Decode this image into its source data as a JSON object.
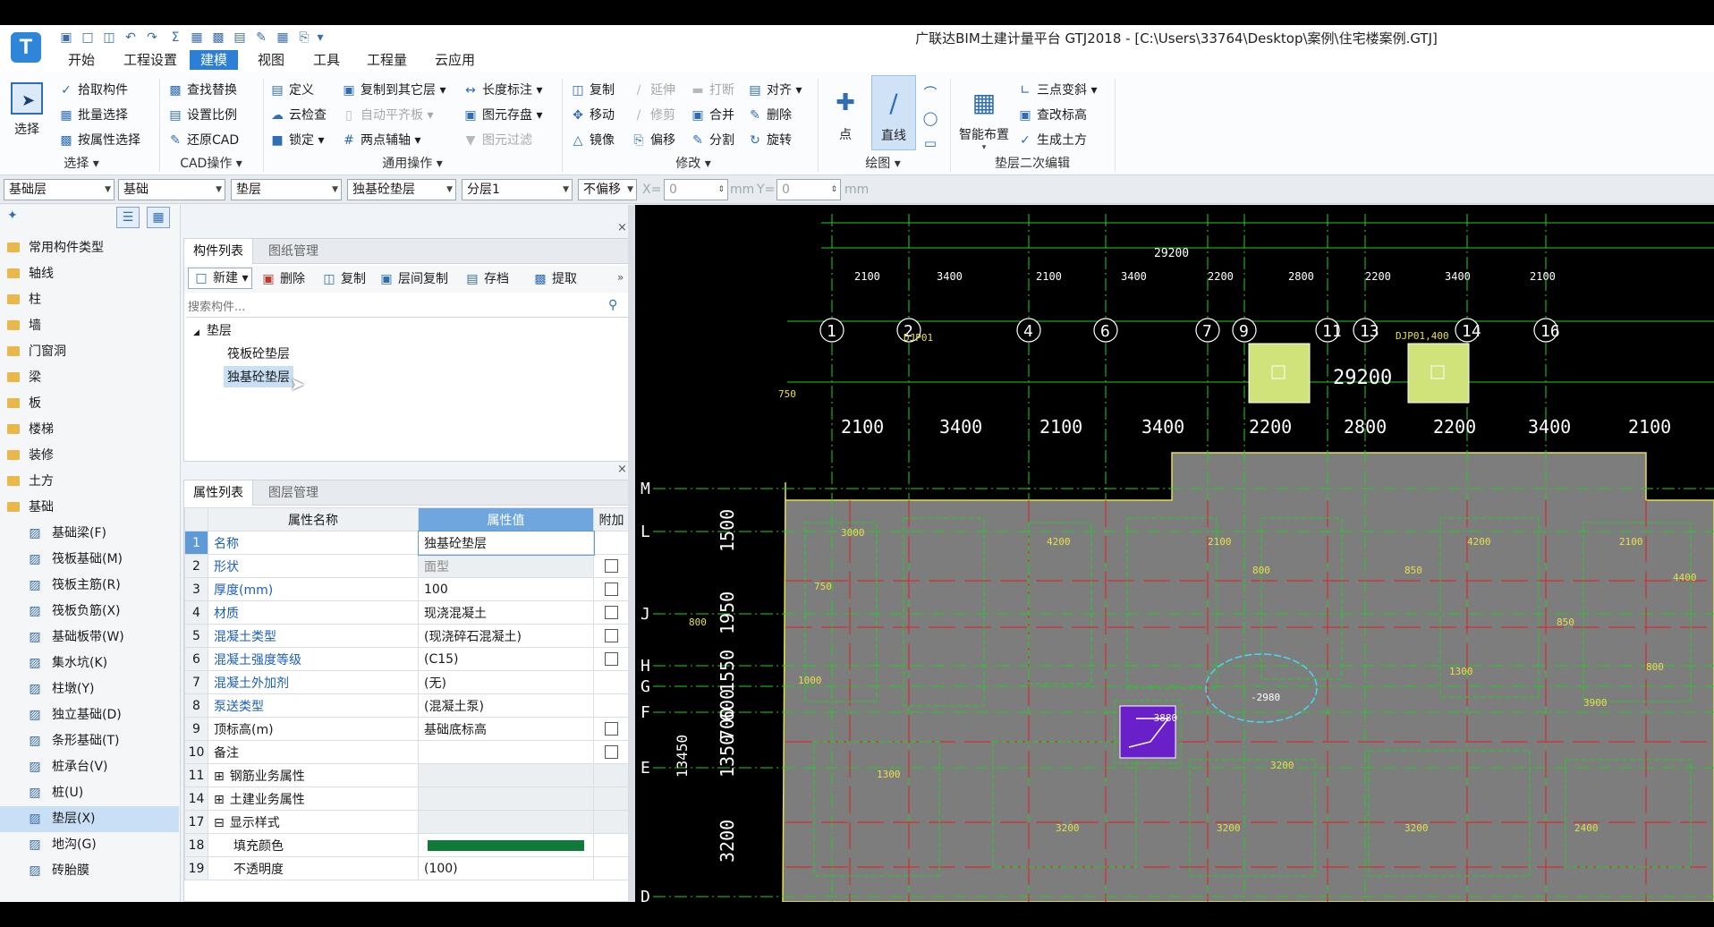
{
  "app": {
    "window_title": "广联达BIM土建计量平台 GTJ2018 - [C:\\Users\\33764\\Desktop\\案例\\住宅楼案例.GTJ]",
    "logo_letter": "T",
    "tabs": [
      "开始",
      "工程设置",
      "建模",
      "视图",
      "工具",
      "工程量",
      "云应用"
    ],
    "active_tab": "建模"
  },
  "ribbon": {
    "select_label": "选择",
    "group_select": [
      "拾取构件",
      "批量选择",
      "按属性选择"
    ],
    "group_select_title": "选择",
    "group_cad": [
      "查找替换",
      "设置比例",
      "还原CAD"
    ],
    "group_cad_title": "CAD操作",
    "group_general_col1": [
      "定义",
      "云检查",
      "锁定"
    ],
    "group_general_col2": [
      "复制到其它层",
      "自动平齐板",
      "两点辅轴"
    ],
    "group_general_col3": [
      "长度标注",
      "图元存盘",
      "图元过滤"
    ],
    "group_general_title": "通用操作",
    "group_modify_col1": [
      "复制",
      "移动",
      "镜像"
    ],
    "group_modify_col2": [
      "延伸",
      "修剪",
      "偏移"
    ],
    "group_modify_col3": [
      "打断",
      "合并",
      "分割"
    ],
    "group_modify_col4": [
      "对齐",
      "删除",
      "旋转"
    ],
    "group_modify_title": "修改",
    "group_draw_point": "点",
    "group_draw_line": "直线",
    "group_draw_title": "绘图",
    "group_cushion_big": "智能布置",
    "group_cushion_items": [
      "三点变斜",
      "查改标高",
      "生成土方"
    ],
    "group_cushion_title": "垫层二次编辑"
  },
  "selectors": {
    "floor": "基础层",
    "category": "基础",
    "type": "垫层",
    "component": "独基砼垫层",
    "layer": "分层1",
    "offset": "不偏移",
    "x_label": "X=",
    "x_value": "0",
    "x_unit": "mm",
    "y_label": "Y=",
    "y_value": "0",
    "y_unit": "mm"
  },
  "nav": {
    "items": [
      {
        "label": "常用构件类型",
        "kind": "folder"
      },
      {
        "label": "轴线",
        "kind": "folder"
      },
      {
        "label": "柱",
        "kind": "folder"
      },
      {
        "label": "墙",
        "kind": "folder"
      },
      {
        "label": "门窗洞",
        "kind": "folder"
      },
      {
        "label": "梁",
        "kind": "folder"
      },
      {
        "label": "板",
        "kind": "folder"
      },
      {
        "label": "楼梯",
        "kind": "folder"
      },
      {
        "label": "装修",
        "kind": "folder"
      },
      {
        "label": "土方",
        "kind": "folder"
      },
      {
        "label": "基础",
        "kind": "folder-open"
      },
      {
        "label": "基础梁(F)",
        "kind": "sub"
      },
      {
        "label": "筏板基础(M)",
        "kind": "sub"
      },
      {
        "label": "筏板主筋(R)",
        "kind": "sub"
      },
      {
        "label": "筏板负筋(X)",
        "kind": "sub"
      },
      {
        "label": "基础板带(W)",
        "kind": "sub"
      },
      {
        "label": "集水坑(K)",
        "kind": "sub"
      },
      {
        "label": "柱墩(Y)",
        "kind": "sub"
      },
      {
        "label": "独立基础(D)",
        "kind": "sub"
      },
      {
        "label": "条形基础(T)",
        "kind": "sub"
      },
      {
        "label": "桩承台(V)",
        "kind": "sub"
      },
      {
        "label": "桩(U)",
        "kind": "sub"
      },
      {
        "label": "垫层(X)",
        "kind": "sub-selected"
      },
      {
        "label": "地沟(G)",
        "kind": "sub"
      },
      {
        "label": "砖胎膜",
        "kind": "sub"
      }
    ]
  },
  "component_panel": {
    "tabs": [
      "构件列表",
      "图纸管理"
    ],
    "toolbar": [
      "新建",
      "删除",
      "复制",
      "层间复制",
      "存档",
      "提取"
    ],
    "search_placeholder": "搜索构件...",
    "tree_root": "垫层",
    "tree_items": [
      "筏板砼垫层",
      "独基砼垫层"
    ],
    "selected_item": "独基砼垫层"
  },
  "property_panel": {
    "tabs": [
      "属性列表",
      "图层管理"
    ],
    "headers": [
      "属性名称",
      "属性值",
      "附加"
    ],
    "rows": [
      {
        "n": "1",
        "name": "名称",
        "value": "独基砼垫层",
        "blue": true,
        "cb": false
      },
      {
        "n": "2",
        "name": "形状",
        "value": "面型",
        "blue": true,
        "cb": true,
        "grey": true
      },
      {
        "n": "3",
        "name": "厚度(mm)",
        "value": "100",
        "blue": true,
        "cb": true
      },
      {
        "n": "4",
        "name": "材质",
        "value": "现浇混凝土",
        "blue": true,
        "cb": true
      },
      {
        "n": "5",
        "name": "混凝土类型",
        "value": "(现浇碎石混凝土)",
        "blue": true,
        "cb": true
      },
      {
        "n": "6",
        "name": "混凝土强度等级",
        "value": "(C15)",
        "blue": true,
        "cb": true
      },
      {
        "n": "7",
        "name": "混凝土外加剂",
        "value": "(无)",
        "blue": true,
        "cb": false
      },
      {
        "n": "8",
        "name": "泵送类型",
        "value": "(混凝土泵)",
        "blue": true,
        "cb": false
      },
      {
        "n": "9",
        "name": "顶标高(m)",
        "value": "基础底标高",
        "blue": false,
        "cb": true
      },
      {
        "n": "10",
        "name": "备注",
        "value": "",
        "blue": false,
        "cb": true
      },
      {
        "n": "11",
        "name": "钢筋业务属性",
        "value": "",
        "blue": false,
        "cb": false,
        "group": "+"
      },
      {
        "n": "14",
        "name": "土建业务属性",
        "value": "",
        "blue": false,
        "cb": false,
        "group": "+"
      },
      {
        "n": "17",
        "name": "显示样式",
        "value": "",
        "blue": false,
        "cb": false,
        "group": "-"
      },
      {
        "n": "18",
        "name": "填充颜色",
        "value": "",
        "blue": false,
        "cb": false,
        "indent": true,
        "swatch": "#0f7a3a"
      },
      {
        "n": "19",
        "name": "不透明度",
        "value": "(100)",
        "blue": false,
        "cb": false,
        "indent": true
      }
    ]
  },
  "drawing": {
    "top_total": "29200",
    "top_dims": [
      "2100",
      "3400",
      "2100",
      "3400",
      "2200",
      "2800",
      "2200",
      "3400",
      "2100"
    ],
    "axes": [
      "1",
      "2",
      "4",
      "6",
      "7",
      "9",
      "11",
      "13",
      "14",
      "16"
    ],
    "mid_total": "29200",
    "mid_dims": [
      "2100",
      "3400",
      "2100",
      "3400",
      "2200",
      "2800",
      "2200",
      "3400",
      "2100"
    ],
    "row_axes": [
      "M",
      "L",
      "J",
      "H",
      "G",
      "F",
      "E",
      "D"
    ],
    "left_dims": [
      "1500",
      "1950",
      "1550",
      "600",
      "700",
      "1350",
      "3200"
    ],
    "left_total": "13450",
    "small_labels": [
      "DJP01",
      "DJP01,400",
      "3000",
      "4200",
      "2100",
      "4200",
      "2100",
      "4400",
      "1300",
      "1300",
      "3200",
      "3200",
      "3200",
      "3200",
      "2400",
      "1000",
      "800",
      "800",
      "850",
      "750",
      "750",
      "850",
      "800",
      "3900",
      "-3880",
      "-2980"
    ],
    "colors": {
      "grid": "#1fd11f",
      "axis": "#ffffff",
      "slab": "#7d7d7d",
      "slab_edge": "#e6e04a",
      "pad": "#cfe37a",
      "beam_red": "#e02020",
      "selected_pad": "#6a20c8",
      "cloud": "#49d8f0"
    }
  }
}
